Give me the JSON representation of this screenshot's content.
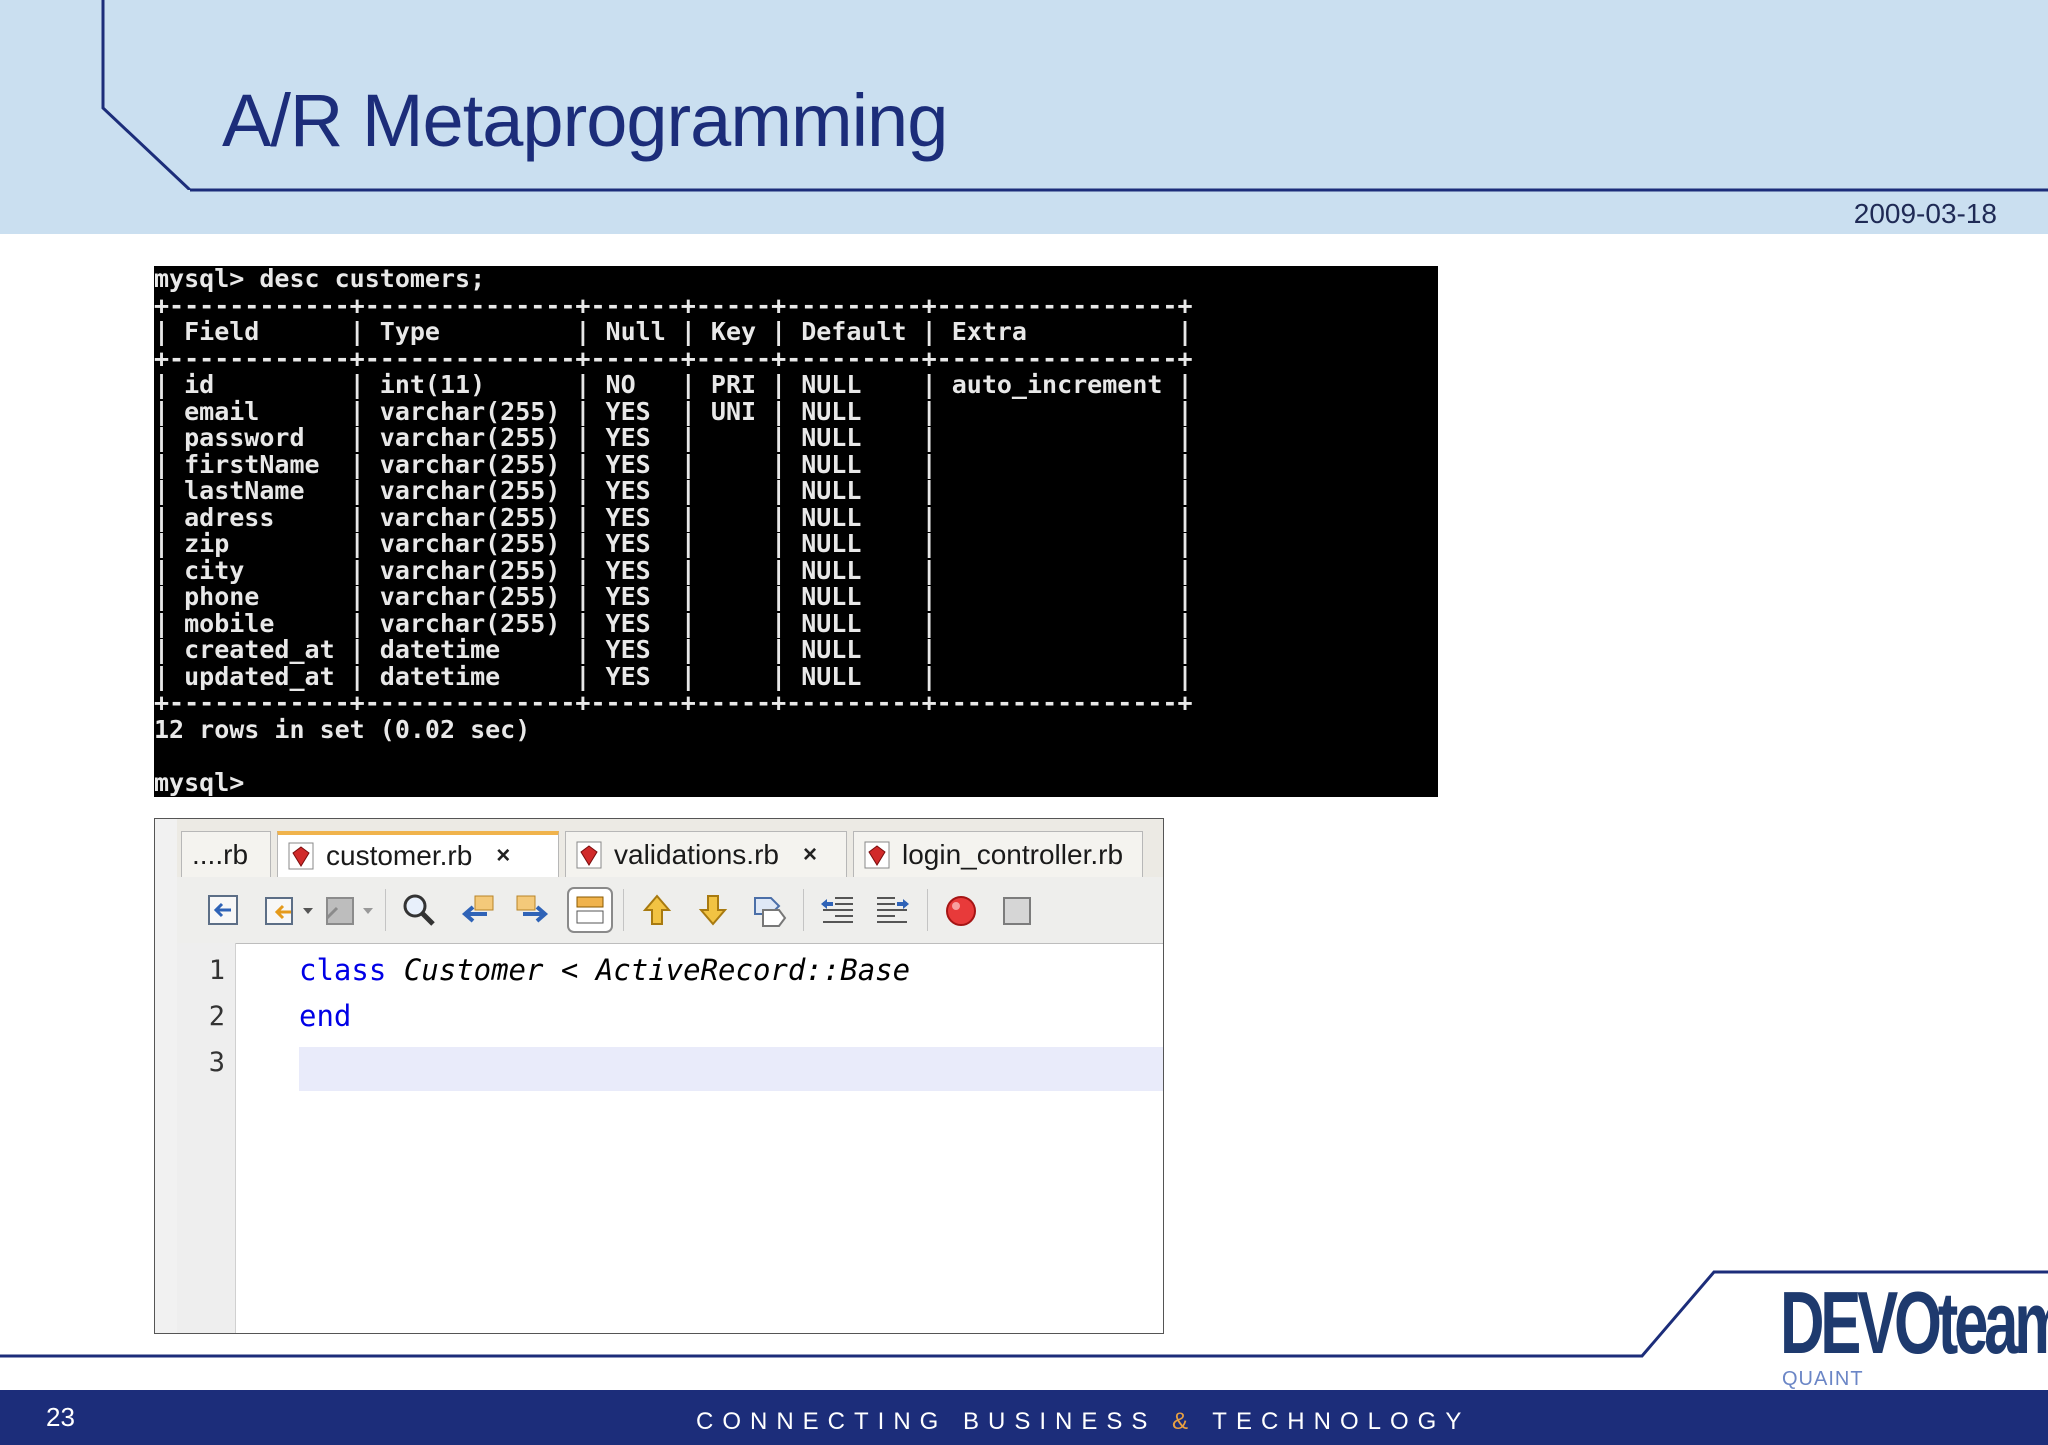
{
  "slide": {
    "title": "A/R Metaprogramming",
    "date": "2009-03-18",
    "page_number": "23",
    "tagline_left": "CONNECTING BUSINESS ",
    "tagline_amp": "&",
    "tagline_right": " TECHNOLOGY",
    "logo_text": "DEVOteam",
    "logo_sub": "QUAINT"
  },
  "console": {
    "text": "mysql> desc customers;\n+------------+--------------+------+-----+---------+----------------+\n| Field      | Type         | Null | Key | Default | Extra          |\n+------------+--------------+------+-----+---------+----------------+\n| id         | int(11)      | NO   | PRI | NULL    | auto_increment |\n| email      | varchar(255) | YES  | UNI | NULL    |                |\n| password   | varchar(255) | YES  |     | NULL    |                |\n| firstName  | varchar(255) | YES  |     | NULL    |                |\n| lastName   | varchar(255) | YES  |     | NULL    |                |\n| adress     | varchar(255) | YES  |     | NULL    |                |\n| zip        | varchar(255) | YES  |     | NULL    |                |\n| city       | varchar(255) | YES  |     | NULL    |                |\n| phone      | varchar(255) | YES  |     | NULL    |                |\n| mobile     | varchar(255) | YES  |     | NULL    |                |\n| created_at | datetime     | YES  |     | NULL    |                |\n| updated_at | datetime     | YES  |     | NULL    |                |\n+------------+--------------+------+-----+---------+----------------+\n12 rows in set (0.02 sec)\n\nmysql>"
  },
  "editor": {
    "tabs": [
      {
        "label": "....rb"
      },
      {
        "label": "customer.rb",
        "close": "×"
      },
      {
        "label": "validations.rb",
        "close": "×"
      },
      {
        "label": "login_controller.rb"
      }
    ],
    "line_numbers": [
      "1",
      "2",
      "3"
    ],
    "code": {
      "kw_class": "class",
      "class_decl": " Customer < ActiveRecord::Base",
      "kw_end": "end"
    }
  }
}
